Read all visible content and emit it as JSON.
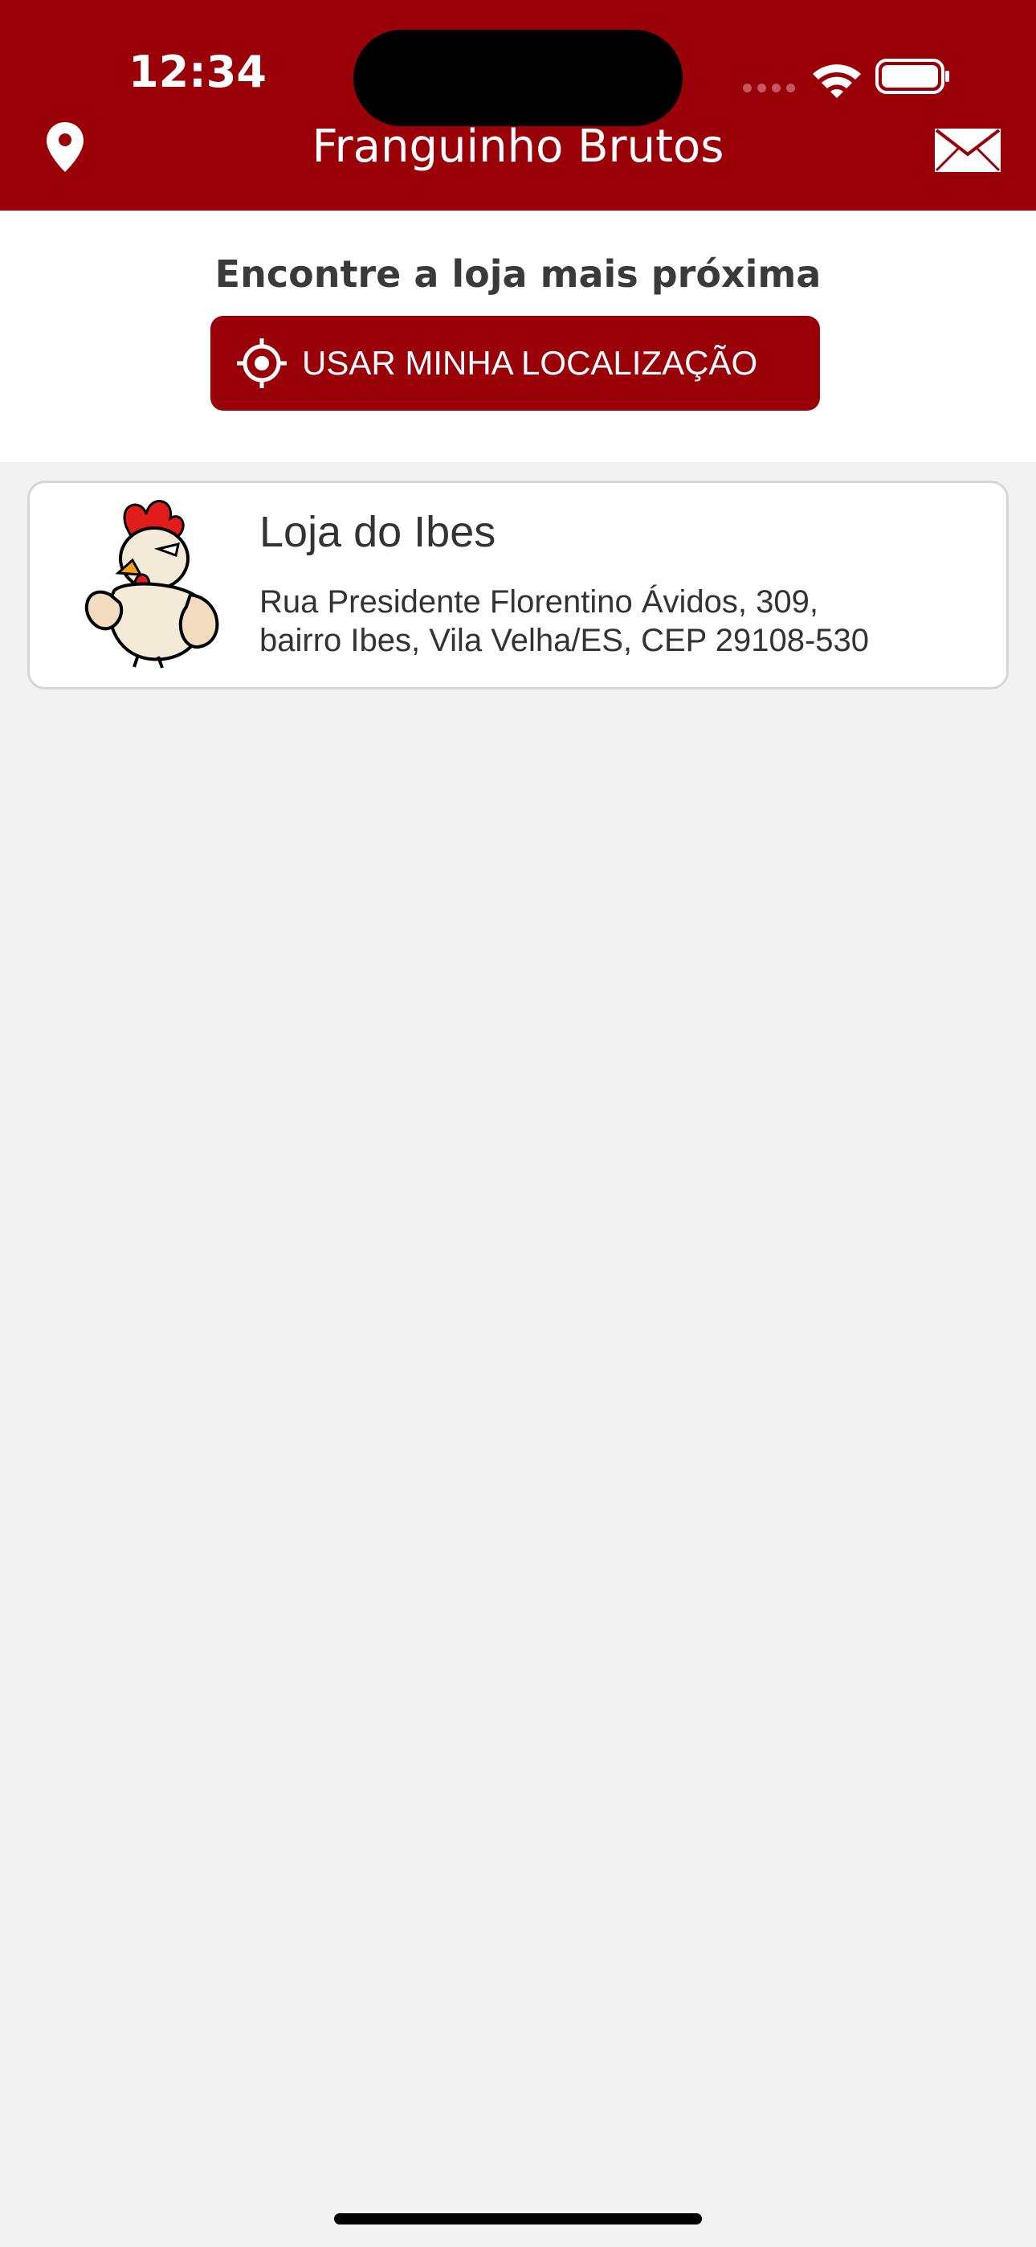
{
  "status_bar": {
    "time": "12:34"
  },
  "header": {
    "title": "Franguinho Brutos",
    "left_icon": "map-pin-icon",
    "right_icon": "mail-icon"
  },
  "locate": {
    "heading": "Encontre a loja mais próxima",
    "button_label": "USAR MINHA LOCALIZAÇÃO",
    "button_icon": "crosshair-icon"
  },
  "stores": [
    {
      "name": "Loja do Ibes",
      "address_line1": "Rua Presidente Florentino Ávidos, 309,",
      "address_line2": "bairro Ibes, Vila Velha/ES, CEP 29108-530",
      "logo": "rooster-mascot-logo"
    }
  ],
  "colors": {
    "brand": "#9a0007",
    "background": "#f2f2f2",
    "card": "#ffffff"
  }
}
